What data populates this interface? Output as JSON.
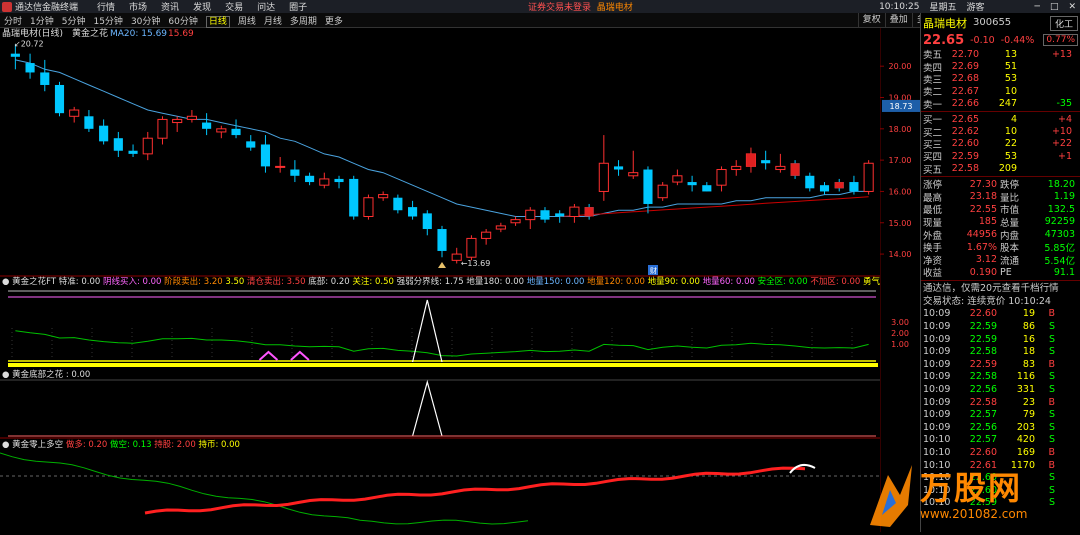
{
  "title": {
    "app": "通达信金融终端",
    "menus": [
      "行情",
      "市场",
      "资讯",
      "发现",
      "交易",
      "问达",
      "圈子"
    ],
    "notice": "证券交易未登录",
    "stock": "晶瑞电材",
    "time": "10:10:25",
    "weekday": "星期五",
    "guest": "游客"
  },
  "toolbar": {
    "timeframes": [
      "分时",
      "1分钟",
      "5分钟",
      "15分钟",
      "30分钟",
      "60分钟",
      "日线",
      "周线",
      "月线",
      "多周期",
      "更多"
    ],
    "active": "日线",
    "buttons": [
      "复权",
      "叠加",
      "多股",
      "统计",
      "画线",
      "F10",
      "+自选",
      "返回"
    ]
  },
  "chart": {
    "header": "晶瑞电材(日线)",
    "indicator": "黄金之花",
    "ma_label": "MA20: 15.69",
    "ma_val": "15.69",
    "high_label": "20.72",
    "low_label": "13.69",
    "cur_price_tag": "18.73",
    "y_ticks": [
      "20.00",
      "19.00",
      "18.00",
      "17.00",
      "16.00",
      "15.00",
      "14.00"
    ],
    "y_range": [
      13.3,
      20.9
    ],
    "candles": [
      [
        20.4,
        20.7,
        19.9,
        20.3
      ],
      [
        20.1,
        20.4,
        19.6,
        19.8
      ],
      [
        19.8,
        20.2,
        19.2,
        19.4
      ],
      [
        19.4,
        19.5,
        18.4,
        18.5
      ],
      [
        18.4,
        18.7,
        18.2,
        18.6
      ],
      [
        18.4,
        18.6,
        17.9,
        18.0
      ],
      [
        18.1,
        18.3,
        17.5,
        17.6
      ],
      [
        17.7,
        17.9,
        17.1,
        17.3
      ],
      [
        17.3,
        17.5,
        17.1,
        17.2
      ],
      [
        17.2,
        17.9,
        17.0,
        17.7
      ],
      [
        17.7,
        18.4,
        17.5,
        18.3
      ],
      [
        18.2,
        18.4,
        17.9,
        18.3
      ],
      [
        18.3,
        18.6,
        18.2,
        18.4
      ],
      [
        18.2,
        18.5,
        17.8,
        18.0
      ],
      [
        17.9,
        18.1,
        17.7,
        18.0
      ],
      [
        18.0,
        18.3,
        17.7,
        17.8
      ],
      [
        17.6,
        17.8,
        17.3,
        17.4
      ],
      [
        17.5,
        17.8,
        16.6,
        16.8
      ],
      [
        16.8,
        17.1,
        16.6,
        16.8
      ],
      [
        16.7,
        17.0,
        16.3,
        16.5
      ],
      [
        16.5,
        16.6,
        16.2,
        16.3
      ],
      [
        16.2,
        16.6,
        16.1,
        16.4
      ],
      [
        16.4,
        16.5,
        16.1,
        16.3
      ],
      [
        16.4,
        16.5,
        15.1,
        15.2
      ],
      [
        15.2,
        15.9,
        15.1,
        15.8
      ],
      [
        15.8,
        16.0,
        15.7,
        15.9
      ],
      [
        15.8,
        15.9,
        15.3,
        15.4
      ],
      [
        15.5,
        15.7,
        15.1,
        15.2
      ],
      [
        15.3,
        15.4,
        14.6,
        14.8
      ],
      [
        14.8,
        14.9,
        13.9,
        14.1
      ],
      [
        13.8,
        14.2,
        13.7,
        14.0
      ],
      [
        13.9,
        14.6,
        13.8,
        14.5
      ],
      [
        14.5,
        14.8,
        14.3,
        14.7
      ],
      [
        14.8,
        15.0,
        14.7,
        14.9
      ],
      [
        15.0,
        15.2,
        14.9,
        15.1
      ],
      [
        15.1,
        15.5,
        14.8,
        15.4
      ],
      [
        15.4,
        15.5,
        15.0,
        15.1
      ],
      [
        15.3,
        15.4,
        15.0,
        15.2
      ],
      [
        15.2,
        15.6,
        15.0,
        15.5
      ],
      [
        15.5,
        15.6,
        15.1,
        15.2
      ],
      [
        16.0,
        17.8,
        15.7,
        16.9
      ],
      [
        16.8,
        17.0,
        16.5,
        16.7
      ],
      [
        16.5,
        17.3,
        16.4,
        16.6
      ],
      [
        16.7,
        16.8,
        15.3,
        15.6
      ],
      [
        15.8,
        16.3,
        15.7,
        16.2
      ],
      [
        16.3,
        16.7,
        16.2,
        16.5
      ],
      [
        16.3,
        16.5,
        16.0,
        16.2
      ],
      [
        16.2,
        16.3,
        16.0,
        16.0
      ],
      [
        16.2,
        16.8,
        16.0,
        16.7
      ],
      [
        16.7,
        17.0,
        16.5,
        16.8
      ],
      [
        16.8,
        17.4,
        16.6,
        17.2
      ],
      [
        17.0,
        17.3,
        16.7,
        16.9
      ],
      [
        16.7,
        17.2,
        16.6,
        16.8
      ],
      [
        16.9,
        17.0,
        16.4,
        16.5
      ],
      [
        16.5,
        16.6,
        16.0,
        16.1
      ],
      [
        16.2,
        16.3,
        15.9,
        16.0
      ],
      [
        16.3,
        16.4,
        16.0,
        16.1
      ],
      [
        16.3,
        16.5,
        15.9,
        16.0
      ],
      [
        16.0,
        17.0,
        15.9,
        16.9
      ]
    ],
    "ma": [
      20.2,
      20.1,
      19.9,
      19.8,
      19.6,
      19.4,
      19.2,
      19.0,
      18.8,
      18.6,
      18.5,
      18.4,
      18.3,
      18.3,
      18.2,
      18.1,
      18.0,
      17.9,
      17.7,
      17.6,
      17.4,
      17.2,
      17.1,
      16.9,
      16.7,
      16.6,
      16.4,
      16.2,
      16.0,
      15.8,
      15.6,
      15.5,
      15.4,
      15.3,
      15.2,
      15.2,
      15.2,
      15.2,
      15.2,
      15.2,
      15.3,
      15.4,
      15.4,
      15.5,
      15.5,
      15.6,
      15.6,
      15.6,
      15.6,
      15.7,
      15.7,
      15.8,
      15.8,
      15.8,
      15.8,
      15.9,
      15.9,
      16.0,
      16.0
    ]
  },
  "sub1": {
    "title": "黄金之花FT",
    "labels": [
      [
        "特准",
        "0.00"
      ],
      [
        "阴线买入",
        "0.00"
      ],
      [
        "阶段卖出",
        "3.20"
      ],
      [
        "",
        "3.50"
      ],
      [
        "清仓卖出",
        "3.50"
      ],
      [
        "底部",
        "0.20"
      ],
      [
        "关注",
        "0.50"
      ],
      [
        "强弱分界线",
        "1.75"
      ],
      [
        "地量180",
        "0.00"
      ],
      [
        "地量150",
        "0.00"
      ],
      [
        "地量120",
        "0.00"
      ],
      [
        "地量90",
        "0.00"
      ],
      [
        "地量60",
        "0.00"
      ],
      [
        "安全区",
        "0.00"
      ],
      [
        "不加区",
        "0.00"
      ],
      [
        "勇气区",
        "0.00"
      ]
    ],
    "y_ticks": [
      "3.00",
      "2.00",
      "1.00"
    ],
    "tag": "财"
  },
  "sub2": {
    "title": "黄金底部之花",
    "value": "0.00"
  },
  "sub3": {
    "title": "黄金零上多空",
    "labels": [
      [
        "做多",
        "0.20"
      ],
      [
        "做空",
        "0.13"
      ],
      [
        "持股",
        "2.00"
      ],
      [
        "持币",
        "0.00"
      ]
    ]
  },
  "panel": {
    "name": "晶瑞电材",
    "code": "300655",
    "ind": "化工",
    "price": "22.65",
    "chg": "-0.10",
    "pct": "-0.44%",
    "pct2": "0.77%",
    "asks": [
      [
        "卖五",
        "22.70",
        "13",
        "+13"
      ],
      [
        "卖四",
        "22.69",
        "51",
        ""
      ],
      [
        "卖三",
        "22.68",
        "53",
        ""
      ],
      [
        "卖二",
        "22.67",
        "10",
        ""
      ],
      [
        "卖一",
        "22.66",
        "247",
        "-35"
      ]
    ],
    "bids": [
      [
        "买一",
        "22.65",
        "4",
        "+4"
      ],
      [
        "买二",
        "22.62",
        "10",
        "+10"
      ],
      [
        "买三",
        "22.60",
        "22",
        "+22"
      ],
      [
        "买四",
        "22.59",
        "53",
        "+1"
      ],
      [
        "买五",
        "22.58",
        "209",
        ""
      ]
    ],
    "stats": [
      [
        "涨停",
        "27.30",
        "跌停",
        "18.20"
      ],
      [
        "最高",
        "23.18",
        "量比",
        "1.19"
      ],
      [
        "最低",
        "22.55",
        "市值",
        "132.5"
      ],
      [
        "现量",
        "185",
        "总量",
        "92259"
      ],
      [
        "外盘",
        "44956",
        "内盘",
        "47303"
      ],
      [
        "换手",
        "1.67%",
        "股本",
        "5.85亿"
      ],
      [
        "净资",
        "3.12",
        "流通",
        "5.54亿"
      ],
      [
        "收益",
        "0.190",
        "PE",
        "91.1"
      ]
    ],
    "msg1": "通达信，仅需20元查看千档行情",
    "msg2": "交易状态: 连续竞价  10:10:24",
    "ticks": [
      [
        "10:09",
        "22.60",
        "19",
        "B"
      ],
      [
        "10:09",
        "22.59",
        "86",
        "S"
      ],
      [
        "10:09",
        "22.59",
        "16",
        "S"
      ],
      [
        "10:09",
        "22.58",
        "18",
        "S"
      ],
      [
        "10:09",
        "22.59",
        "83",
        "B"
      ],
      [
        "10:09",
        "22.58",
        "116",
        "S"
      ],
      [
        "10:09",
        "22.56",
        "331",
        "S"
      ],
      [
        "10:09",
        "22.58",
        "23",
        "B"
      ],
      [
        "10:09",
        "22.57",
        "79",
        "S"
      ],
      [
        "10:09",
        "22.56",
        "203",
        "S"
      ],
      [
        "10:10",
        "22.57",
        "420",
        "S"
      ],
      [
        "10:10",
        "22.60",
        "169",
        "B"
      ],
      [
        "10:10",
        "22.61",
        "1170",
        "B"
      ],
      [
        "10:10",
        "22.60",
        "",
        "S"
      ],
      [
        "10:10",
        "22.60",
        "",
        "S"
      ],
      [
        "10:10",
        "22.59",
        "",
        "S"
      ]
    ]
  },
  "watermark": {
    "logo": "万股网",
    "url": "www.201082.com"
  }
}
